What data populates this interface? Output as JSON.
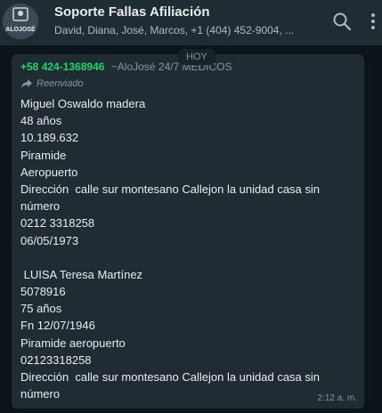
{
  "header": {
    "title": "Soporte Fallas Afiliación",
    "subtitle": "David, Diana, José, Marcos, +1 (404) 452-9004, ...",
    "avatar_text": "ALOJOSÉ",
    "icons": [
      "search-icon",
      "more-vert-icon"
    ]
  },
  "chat": {
    "date_label": "HOY",
    "message": {
      "sender_phone": "+58 424-1368946",
      "sender_name": "~AloJosé 24/7 MEDICOS",
      "forwarded_label": "Reenviado",
      "lines": [
        "Miguel Oswaldo madera",
        "48 años",
        "10.189.632",
        "Piramide",
        "Aeropuerto",
        "Dirección  calle sur montesano Callejon la unidad casa sin",
        "número",
        "0212 3318258",
        "06/05/1973",
        "",
        " LUISA Teresa Martínez",
        "5078916",
        "75 años",
        "Fn 12/07/1946",
        "Piramide aeropuerto",
        "02123318258",
        "Dirección  calle sur montesano Callejon la unidad casa sin",
        "número"
      ],
      "time": "2:12 a. m."
    }
  },
  "colors": {
    "header_bg": "#202c33",
    "chat_bg": "#0b141a",
    "bubble_bg": "#202c33",
    "sender_phone": "#25d366",
    "muted_text": "#8696a0"
  }
}
